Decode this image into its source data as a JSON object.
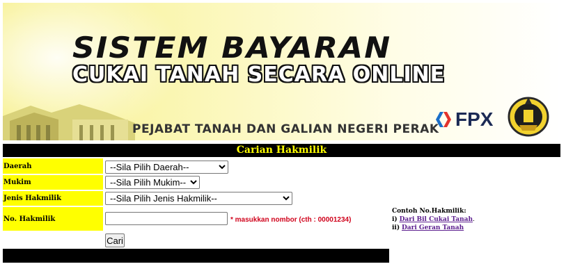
{
  "banner": {
    "title_line1": "SISTEM BAYARAN",
    "title_line2": "CUKAI TANAH SECARA ONLINE",
    "office": "PEJABAT TANAH DAN GALIAN NEGERI PERAK",
    "fpx_label": "FPX",
    "accent_yellow": "#ffff00"
  },
  "search": {
    "title": "Carian Hakmilik",
    "fields": {
      "daerah": {
        "label": "Daerah",
        "selected": "--Sila Pilih Daerah--"
      },
      "mukim": {
        "label": "Mukim",
        "selected": "--Sila Pilih Mukim--"
      },
      "jenis": {
        "label": "Jenis Hakmilik",
        "selected": "--Sila Pilih Jenis Hakmilik--"
      },
      "no_hakmilik": {
        "label": "No. Hakmilik",
        "value": "",
        "hint": "* masukkan nombor (cth : 00001234)"
      }
    },
    "button_label": "Cari"
  },
  "example": {
    "heading": "Contoh No.Hakmilik:",
    "items": [
      {
        "prefix": "i)",
        "link": "Dari Bil Cukai Tanah",
        "suffix": "."
      },
      {
        "prefix": "ii)",
        "link": "Dari Geran Tanah",
        "suffix": ""
      }
    ]
  }
}
